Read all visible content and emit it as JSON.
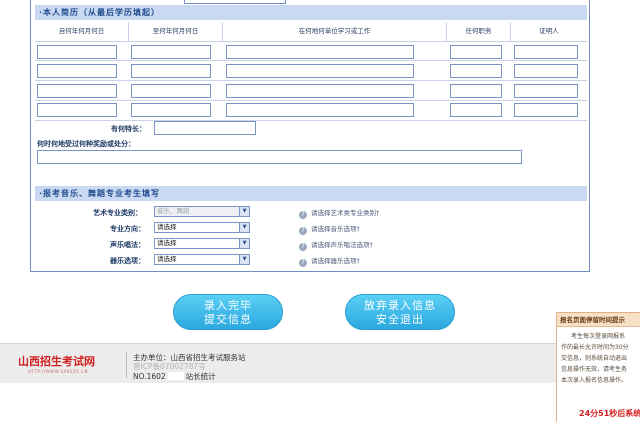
{
  "resume": {
    "title": "·本人简历（从最后学历填起）",
    "columns": [
      "自何年何月何日",
      "至何年何月何日",
      "在何地何单位学习或工作",
      "任何职务",
      "证明人"
    ],
    "rows": 4,
    "specialty_label": "有何特长：",
    "awards_label": "何时何地受过何种奖励或处分："
  },
  "arts": {
    "title": "·报考音乐、舞蹈专业考生填写",
    "fields": [
      {
        "label": "艺术专业类别：",
        "value": "音乐、舞蹈",
        "disabled": true,
        "hint": "请选择艺术类专业类别†"
      },
      {
        "label": "专业方向：",
        "value": "请选择",
        "disabled": false,
        "hint": "请选择音乐选项†"
      },
      {
        "label": "声乐唱法：",
        "value": "请选择",
        "disabled": false,
        "hint": "请选择声乐唱法选项†"
      },
      {
        "label": "器乐选项：",
        "value": "请选择",
        "disabled": false,
        "hint": "请选择器乐选项†"
      }
    ]
  },
  "buttons": {
    "submit_line1": "录入完毕",
    "submit_line2": "提交信息",
    "abandon_line1": "放弃录入信息",
    "abandon_line2": "安全退出"
  },
  "footer": {
    "logo": "山西招生考试网",
    "logo_url": "HTTP://WWW.SXKSZX.CN",
    "host": "主办单位：山西省招生考试服务站",
    "icp": "晋ICP备07002787号",
    "counter_prefix": "NO.1602",
    "counter_suffix": "站长统计"
  },
  "popup": {
    "title": "报名页面停留时间提示",
    "lines": [
      "考生每次登录网报系",
      "作的最长允许时间为30分",
      "交信息，则系统自动退出",
      "信息操作无效，请考生务",
      "本次录入报名信息操作。"
    ],
    "timer": "24分51秒后系统"
  }
}
